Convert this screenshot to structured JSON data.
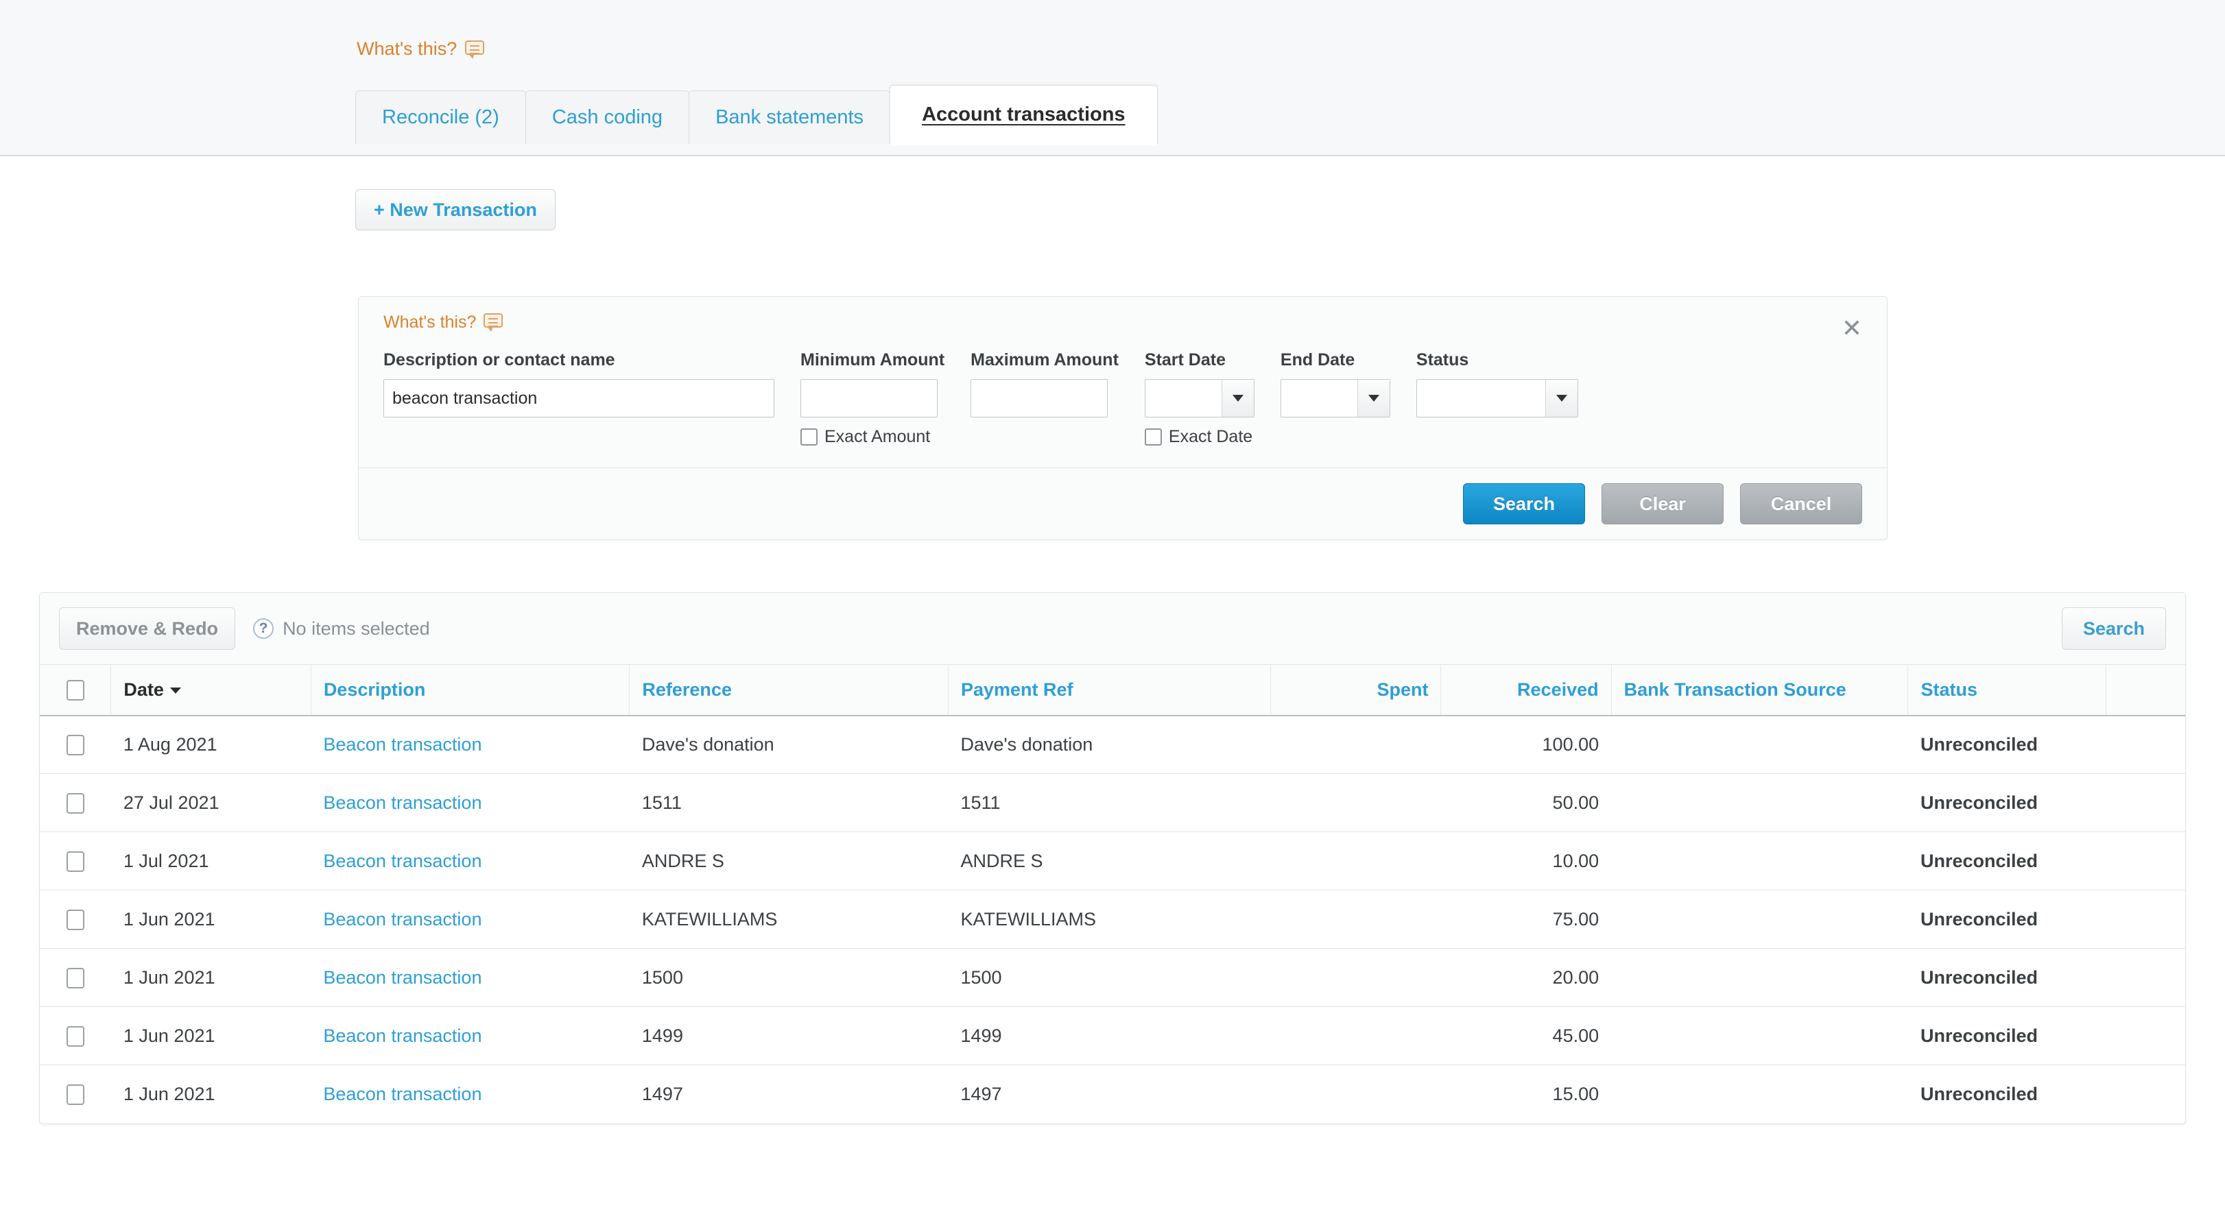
{
  "header": {
    "whats_this_label": "What's this?",
    "whats_this_icon": "speech-bubble-icon"
  },
  "tabs": [
    {
      "label": "Reconcile (2)",
      "active": false
    },
    {
      "label": "Cash coding",
      "active": false
    },
    {
      "label": "Bank statements",
      "active": false
    },
    {
      "label": "Account transactions",
      "active": true
    }
  ],
  "actions": {
    "new_transaction_label": "+ New Transaction"
  },
  "search_panel": {
    "whats_this_label": "What's this?",
    "close_label": "✕",
    "fields": {
      "description": {
        "label": "Description or contact name",
        "value": "beacon transaction"
      },
      "minimum_amount": {
        "label": "Minimum Amount",
        "value": ""
      },
      "maximum_amount": {
        "label": "Maximum Amount",
        "value": ""
      },
      "start_date": {
        "label": "Start Date",
        "value": ""
      },
      "end_date": {
        "label": "End Date",
        "value": ""
      },
      "status": {
        "label": "Status",
        "value": ""
      }
    },
    "checkboxes": {
      "exact_amount": {
        "label": "Exact Amount",
        "checked": false
      },
      "exact_date": {
        "label": "Exact Date",
        "checked": false
      }
    },
    "buttons": {
      "search": "Search",
      "clear": "Clear",
      "cancel": "Cancel"
    }
  },
  "results": {
    "toolbar": {
      "remove_redo_label": "Remove & Redo",
      "help_icon_label": "?",
      "selection_status": "No items selected",
      "search_label": "Search"
    },
    "columns": [
      {
        "key": "checkbox",
        "label": "",
        "type": "checkbox"
      },
      {
        "key": "date",
        "label": "Date",
        "type": "sorted"
      },
      {
        "key": "description",
        "label": "Description",
        "type": "link"
      },
      {
        "key": "reference",
        "label": "Reference",
        "type": "link"
      },
      {
        "key": "payment_ref",
        "label": "Payment Ref",
        "type": "link"
      },
      {
        "key": "spent",
        "label": "Spent",
        "type": "num"
      },
      {
        "key": "received",
        "label": "Received",
        "type": "num"
      },
      {
        "key": "source",
        "label": "Bank Transaction Source",
        "type": "link"
      },
      {
        "key": "status",
        "label": "Status",
        "type": "link"
      }
    ],
    "rows": [
      {
        "date": "1 Aug 2021",
        "description": "Beacon transaction",
        "reference": "Dave's donation",
        "payment_ref": "Dave's donation",
        "spent": "",
        "received": "100.00",
        "source": "",
        "status": "Unreconciled"
      },
      {
        "date": "27 Jul 2021",
        "description": "Beacon transaction",
        "reference": "1511",
        "payment_ref": "1511",
        "spent": "",
        "received": "50.00",
        "source": "",
        "status": "Unreconciled"
      },
      {
        "date": "1 Jul 2021",
        "description": "Beacon transaction",
        "reference": "ANDRE S",
        "payment_ref": "ANDRE S",
        "spent": "",
        "received": "10.00",
        "source": "",
        "status": "Unreconciled"
      },
      {
        "date": "1 Jun 2021",
        "description": "Beacon transaction",
        "reference": "KATEWILLIAMS",
        "payment_ref": "KATEWILLIAMS",
        "spent": "",
        "received": "75.00",
        "source": "",
        "status": "Unreconciled"
      },
      {
        "date": "1 Jun 2021",
        "description": "Beacon transaction",
        "reference": "1500",
        "payment_ref": "1500",
        "spent": "",
        "received": "20.00",
        "source": "",
        "status": "Unreconciled"
      },
      {
        "date": "1 Jun 2021",
        "description": "Beacon transaction",
        "reference": "1499",
        "payment_ref": "1499",
        "spent": "",
        "received": "45.00",
        "source": "",
        "status": "Unreconciled"
      },
      {
        "date": "1 Jun 2021",
        "description": "Beacon transaction",
        "reference": "1497",
        "payment_ref": "1497",
        "spent": "",
        "received": "15.00",
        "source": "",
        "status": "Unreconciled"
      }
    ]
  },
  "colors": {
    "link": "#2e9fd4",
    "accent_orange": "#d9822b",
    "status_orange": "#e8880c",
    "primary_button": "#0d87c4",
    "page_background": "#ffffff",
    "panel_background": "#fafbfb"
  }
}
